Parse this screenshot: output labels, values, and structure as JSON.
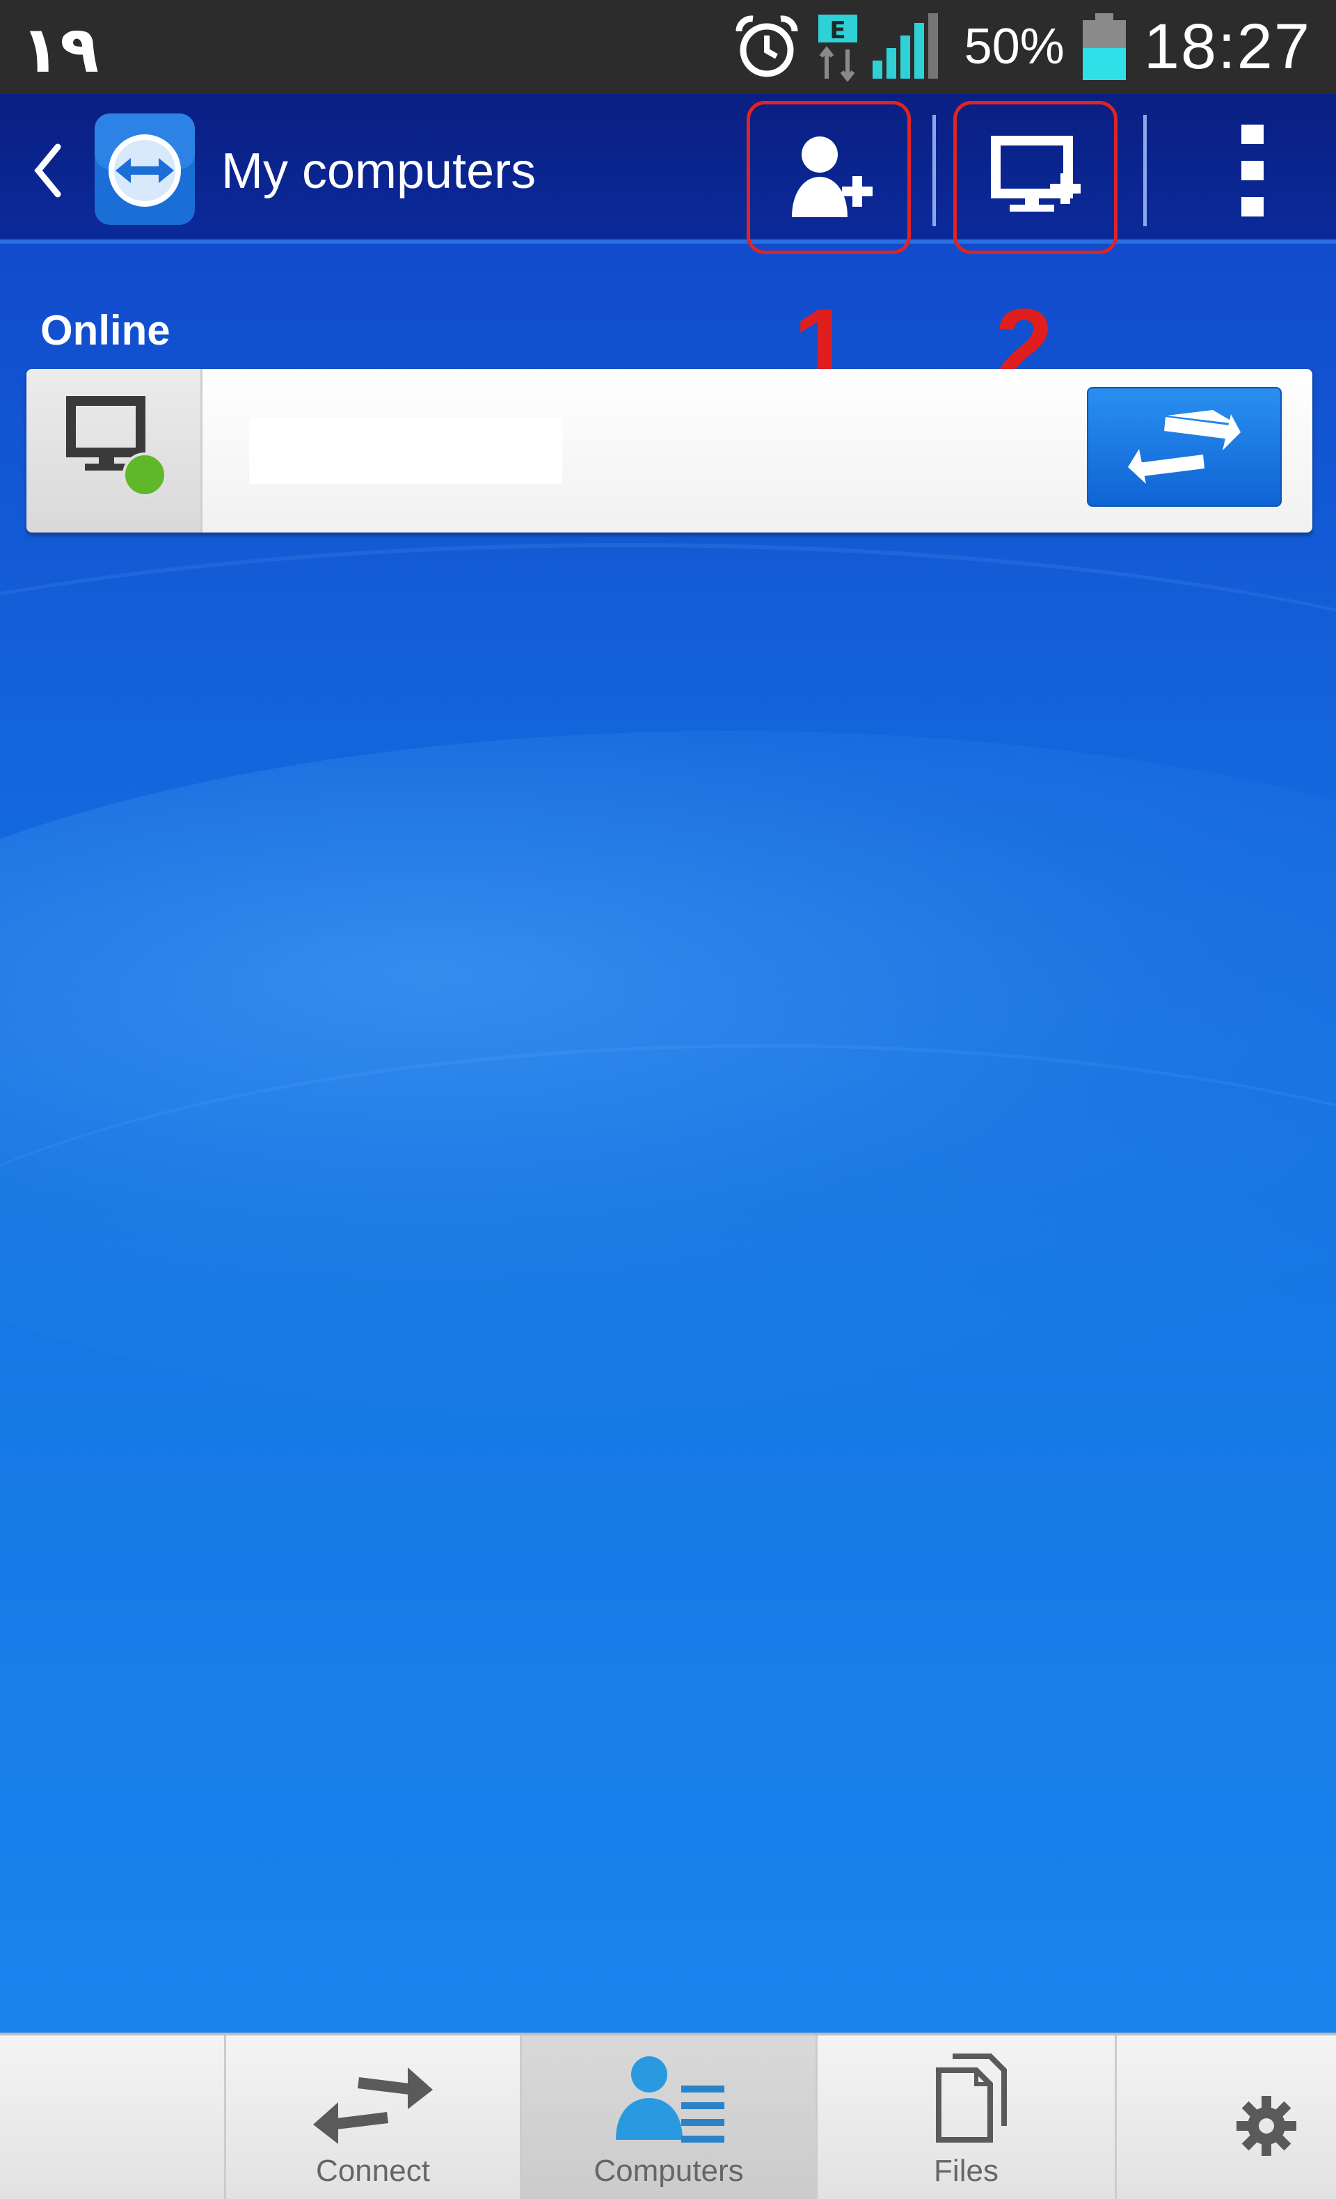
{
  "status_bar": {
    "notification_text": "١٩",
    "battery_percent": "50%",
    "time": "18:27",
    "network_type": "E"
  },
  "action_bar": {
    "title": "My computers"
  },
  "annotations": {
    "callout_1": "1",
    "callout_2": "2"
  },
  "computers": {
    "section_label": "Online",
    "items": [
      {
        "name": ""
      }
    ]
  },
  "bottom_nav": {
    "connect_label": "Connect",
    "computers_label": "Computers",
    "files_label": "Files"
  },
  "colors": {
    "accent_blue": "#1466dc",
    "action_bar": "#0b2a9a",
    "highlight_red": "#e02424",
    "online_green": "#5fb82a"
  }
}
